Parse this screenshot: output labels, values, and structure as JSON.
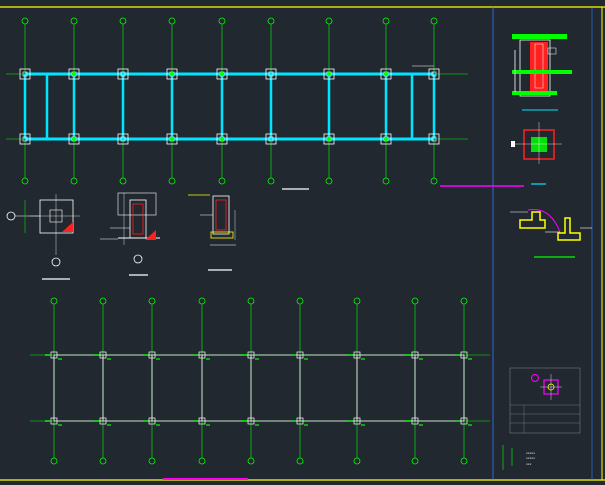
{
  "drawing": {
    "background": "#212830",
    "colors": {
      "frame": "#ffff00",
      "frame_right": "#2f7dff",
      "grid_line": "#00ff00",
      "beam": "#00e5ff",
      "structure": "#ffffff",
      "section_cut": "#ff2020",
      "highlight": "#ff00ff",
      "fill_yellow": "#ffff00"
    },
    "plan_top": {
      "axis_count": 9,
      "row_count": 2
    },
    "plan_bottom": {
      "axis_count": 9,
      "row_count": 2
    },
    "details": [
      {
        "id": "pile-cap-plan"
      },
      {
        "id": "pile-section-a"
      },
      {
        "id": "pile-section-b"
      },
      {
        "id": "column-section-red"
      },
      {
        "id": "column-plan-red"
      },
      {
        "id": "retaining-wall-section"
      },
      {
        "id": "small-pile-detail-legend"
      }
    ],
    "title_block": {
      "lines": [
        "xxxxx",
        "xxxxx",
        "xxx"
      ]
    }
  }
}
